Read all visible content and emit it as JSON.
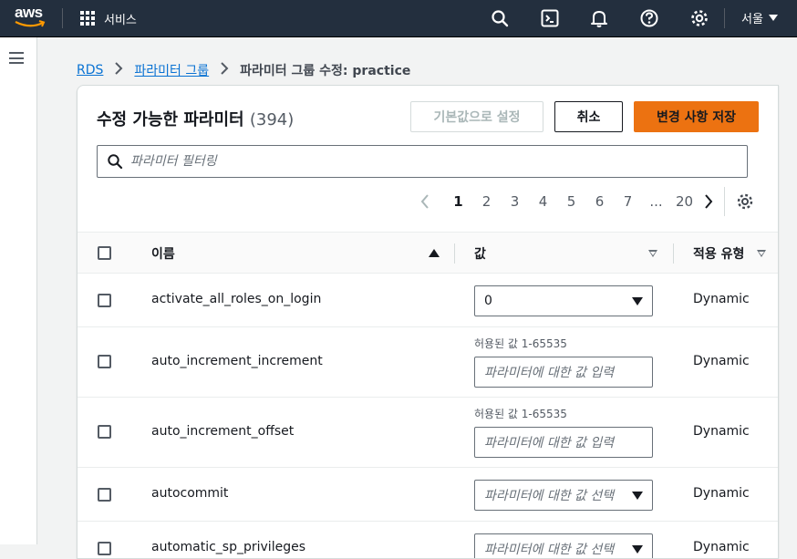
{
  "topbar": {
    "logo": "aws",
    "services_label": "서비스",
    "region_label": "서울",
    "icons": [
      "search-icon",
      "cloudshell-icon",
      "notifications-icon",
      "help-icon",
      "settings-icon"
    ]
  },
  "breadcrumb": {
    "items": [
      {
        "label": "RDS"
      },
      {
        "label": "파라미터 그룹"
      },
      {
        "label": "파라미터 그룹 수정: practice"
      }
    ]
  },
  "panel": {
    "title": "수정 가능한 파라미터",
    "count": "(394)",
    "reset_button": "기본값으로 설정",
    "cancel_button": "취소",
    "save_button": "변경 사항 저장",
    "filter_placeholder": "파라미터 필터링"
  },
  "pagination": {
    "pages": [
      "1",
      "2",
      "3",
      "4",
      "5",
      "6",
      "7",
      "...",
      "20"
    ],
    "current": "1"
  },
  "table": {
    "columns": {
      "name": "이름",
      "value": "값",
      "apply_type": "적용 유형"
    },
    "rows": [
      {
        "name": "activate_all_roles_on_login",
        "value": "0",
        "apply_type": "Dynamic"
      },
      {
        "name": "auto_increment_increment",
        "hint": "허용된 값 1-65535",
        "placeholder": "파라미터에 대한 값 입력",
        "apply_type": "Dynamic"
      },
      {
        "name": "auto_increment_offset",
        "hint": "허용된 값 1-65535",
        "placeholder": "파라미터에 대한 값 입력",
        "apply_type": "Dynamic"
      },
      {
        "name": "autocommit",
        "placeholder": "파라미터에 대한 값 선택",
        "apply_type": "Dynamic"
      },
      {
        "name": "automatic_sp_privileges",
        "placeholder": "파라미터에 대한 값 선택",
        "apply_type": "Dynamic"
      }
    ]
  },
  "colors": {
    "topbar_bg": "#232f3e",
    "primary_button": "#ec7211",
    "link": "#0972d3"
  }
}
